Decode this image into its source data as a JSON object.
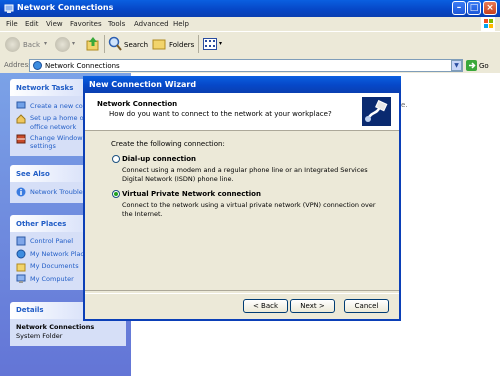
{
  "window": {
    "title": "Network Connections",
    "menu": [
      "File",
      "Edit",
      "View",
      "Favorites",
      "Tools",
      "Advanced",
      "Help"
    ]
  },
  "toolbar": {
    "back_label": "Back",
    "search_label": "Search",
    "folders_label": "Folders"
  },
  "address": {
    "label": "Address",
    "value": "Network Connections",
    "go_label": "Go"
  },
  "task_pane": {
    "network_tasks": {
      "title": "Network Tasks",
      "items": [
        {
          "label": "Create a new conn"
        },
        {
          "label": "Set up a home or small office network"
        },
        {
          "label": "Change Windows Firewall settings"
        }
      ],
      "items_split": [
        [
          "Create a new conn"
        ],
        [
          "Set up a home or s",
          "office network"
        ],
        [
          "Change Windows",
          "settings"
        ]
      ]
    },
    "see_also": {
      "title": "See Also",
      "items": [
        {
          "label": "Network Troubles"
        }
      ]
    },
    "other_places": {
      "title": "Other Places",
      "items": [
        {
          "label": "Control Panel"
        },
        {
          "label": "My Network Place"
        },
        {
          "label": "My Documents"
        },
        {
          "label": "My Computer"
        }
      ]
    },
    "details": {
      "title": "Details",
      "name": "Network Connections",
      "type": "System Folder"
    }
  },
  "behind_text": "e.",
  "wizard": {
    "title": "New Connection Wizard",
    "heading": "Network Connection",
    "subheading": "How do you want to connect to the network at your workplace?",
    "prompt": "Create the following connection:",
    "options": [
      {
        "label": "Dial-up connection",
        "description": "Connect using a modem and a regular phone line or an Integrated Services Digital Network (ISDN) phone line.",
        "selected": false
      },
      {
        "label": "Virtual Private Network connection",
        "description": "Connect to the network using a virtual private network (VPN) connection over the Internet.",
        "selected": true
      }
    ],
    "buttons": {
      "back": "< Back",
      "next": "Next >",
      "cancel": "Cancel"
    }
  },
  "colors": {
    "titlebar": "#0647c7",
    "task_pane": "#6f8fe0",
    "link": "#215dc6",
    "radio_selected": "#21a121"
  }
}
